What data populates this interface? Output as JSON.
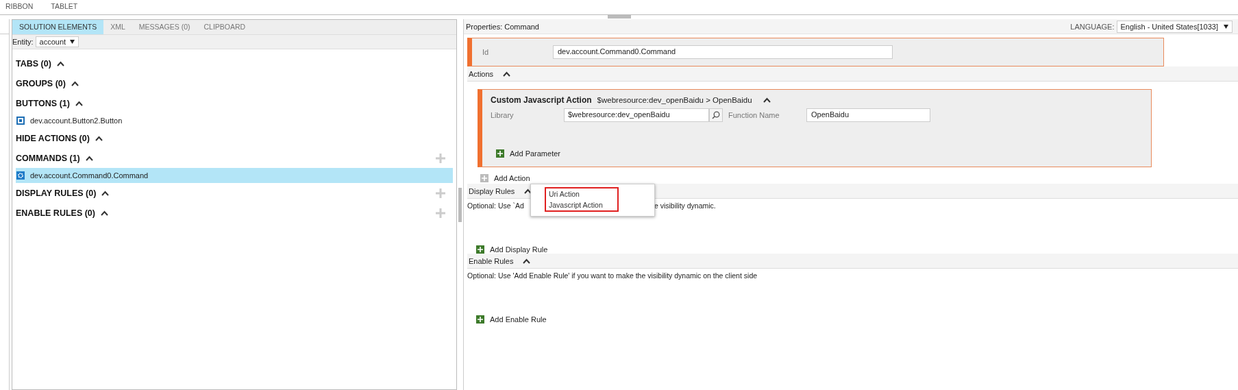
{
  "menu": [
    "RIBBON",
    "TABLET"
  ],
  "left_panel": {
    "tabs": [
      {
        "label": "SOLUTION ELEMENTS",
        "selected": true
      },
      {
        "label": "XML",
        "selected": false
      },
      {
        "label": "MESSAGES (0)",
        "selected": false
      },
      {
        "label": "CLIPBOARD",
        "selected": false
      }
    ],
    "entity": {
      "label": "Entity:",
      "value": "account"
    },
    "sections": [
      {
        "title": "TABS (0)",
        "expanded": true,
        "addable": false
      },
      {
        "title": "GROUPS (0)",
        "expanded": true,
        "addable": false
      },
      {
        "title": "BUTTONS (1)",
        "expanded": true,
        "addable": false,
        "items": [
          {
            "label": "dev.account.Button2.Button",
            "kind": "button",
            "selected": false
          }
        ]
      },
      {
        "title": "HIDE ACTIONS (0)",
        "expanded": true,
        "addable": false
      },
      {
        "title": "COMMANDS (1)",
        "expanded": true,
        "addable": true,
        "items": [
          {
            "label": "dev.account.Command0.Command",
            "kind": "command",
            "selected": true
          }
        ]
      },
      {
        "title": "DISPLAY RULES (0)",
        "expanded": true,
        "addable": true
      },
      {
        "title": "ENABLE RULES (0)",
        "expanded": true,
        "addable": true
      }
    ]
  },
  "properties": {
    "title": "Properties: Command",
    "language": {
      "label": "LANGUAGE:",
      "value": "English - United States[1033]"
    },
    "id": {
      "label": "Id",
      "value": "dev.account.Command0.Command"
    },
    "actions": {
      "title": "Actions",
      "expanded": true,
      "action": {
        "title": "Custom Javascript Action",
        "summary": "$webresource:dev_openBaidu > OpenBaidu",
        "expanded": true,
        "library_label": "Library",
        "library_value": "$webresource:dev_openBaidu",
        "function_label": "Function Name",
        "function_value": "OpenBaidu",
        "add_parameter": "Add Parameter"
      },
      "add_action": "Add Action",
      "popup": {
        "highlighted": true,
        "items": [
          "Uri Action",
          "Javascript Action"
        ]
      }
    },
    "display_rules": {
      "title": "Display Rules",
      "expanded": true,
      "hint_start": "Optional: Use `Ad",
      "hint_end": "e visibility dynamic.",
      "add": "Add Display Rule"
    },
    "enable_rules": {
      "title": "Enable Rules",
      "expanded": true,
      "hint": "Optional: Use 'Add Enable Rule' if you want to make the visibility dynamic on the client side",
      "add": "Add Enable Rule"
    }
  }
}
